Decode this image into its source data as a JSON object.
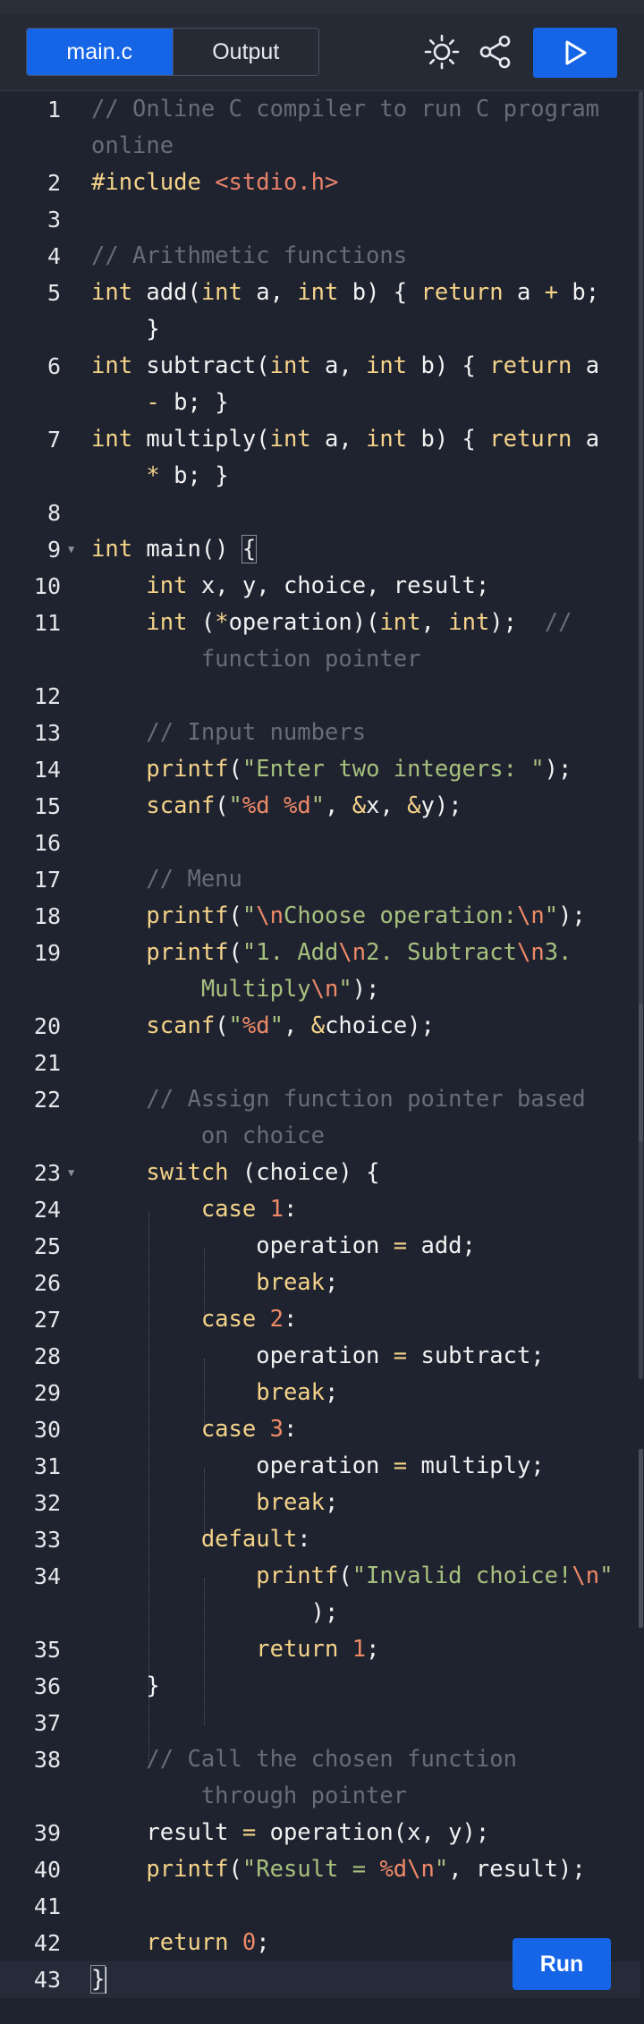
{
  "tabs": [
    {
      "label": "main.c",
      "active": true
    },
    {
      "label": "Output",
      "active": false
    }
  ],
  "toolbar": {
    "theme_icon": "sun-icon",
    "share_icon": "share-icon",
    "run_icon": "play-icon"
  },
  "run_button_label": "Run",
  "colors": {
    "accent": "#1665e6",
    "background": "#1f2330",
    "keyword": "#f5d389",
    "string": "#a6c07e",
    "number": "#ef8a67",
    "comment": "#676c78"
  },
  "code_lines": [
    "// Online C compiler to run C program online",
    "#include <stdio.h>",
    "",
    "// Arithmetic functions",
    "int add(int a, int b) { return a + b; }",
    "int subtract(int a, int b) { return a - b; }",
    "int multiply(int a, int b) { return a * b; }",
    "",
    "int main() {",
    "    int x, y, choice, result;",
    "    int (*operation)(int, int);  // function pointer",
    "",
    "    // Input numbers",
    "    printf(\"Enter two integers: \");",
    "    scanf(\"%d %d\", &x, &y);",
    "",
    "    // Menu",
    "    printf(\"\\nChoose operation:\\n\");",
    "    printf(\"1. Add\\n2. Subtract\\n3. Multiply\\n\");",
    "    scanf(\"%d\", &choice);",
    "",
    "    // Assign function pointer based on choice",
    "    switch (choice) {",
    "        case 1:",
    "            operation = add;",
    "            break;",
    "        case 2:",
    "            operation = subtract;",
    "            break;",
    "        case 3:",
    "            operation = multiply;",
    "            break;",
    "        default:",
    "            printf(\"Invalid choice!\\n\");",
    "            return 1;",
    "    }",
    "",
    "    // Call the chosen function through pointer",
    "    result = operation(x, y);",
    "    printf(\"Result = %d\\n\", result);",
    "",
    "    return 0;",
    "}"
  ]
}
